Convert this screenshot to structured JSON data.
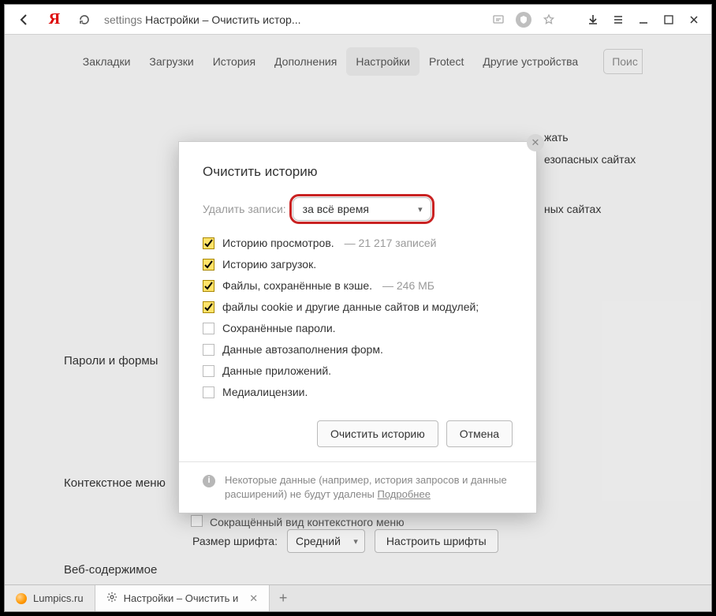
{
  "toolbar": {
    "omni_prefix": "settings",
    "omni_title": "Настройки – Очистить истор..."
  },
  "nav": {
    "tabs": [
      "Закладки",
      "Загрузки",
      "История",
      "Дополнения",
      "Настройки",
      "Protect",
      "Другие устройства"
    ],
    "active_index": 4,
    "search_placeholder": "Поис"
  },
  "bg": {
    "frag1": "жать",
    "frag2": "езопасных сайтах",
    "frag3": "ных сайтах",
    "frag4": "Сокращённый вид контекстного меню"
  },
  "sections": {
    "passwords": "Пароли и формы",
    "context": "Контекстное меню",
    "web": "Веб-содержимое"
  },
  "fontrow": {
    "label": "Размер шрифта:",
    "value": "Средний",
    "button": "Настроить шрифты"
  },
  "dialog": {
    "title": "Очистить историю",
    "delete_label": "Удалить записи:",
    "select_value": "за всё время",
    "items": [
      {
        "checked": true,
        "label": "Историю просмотров.",
        "meta": "—  21 217 записей"
      },
      {
        "checked": true,
        "label": "Историю загрузок."
      },
      {
        "checked": true,
        "label": "Файлы, сохранённые в кэше.",
        "meta": "—  246 МБ"
      },
      {
        "checked": true,
        "label": "файлы cookie и другие данные сайтов и модулей;"
      },
      {
        "checked": false,
        "label": "Сохранённые пароли."
      },
      {
        "checked": false,
        "label": "Данные автозаполнения форм."
      },
      {
        "checked": false,
        "label": "Данные приложений."
      },
      {
        "checked": false,
        "label": "Медиалицензии."
      }
    ],
    "btn_clear": "Очистить историю",
    "btn_cancel": "Отмена",
    "note_text": "Некоторые данные (например, история запросов и данные расширений) не будут удалены ",
    "note_link": "Подробнее"
  },
  "taskbar": {
    "tab1": "Lumpics.ru",
    "tab2": "Настройки – Очистить и"
  }
}
